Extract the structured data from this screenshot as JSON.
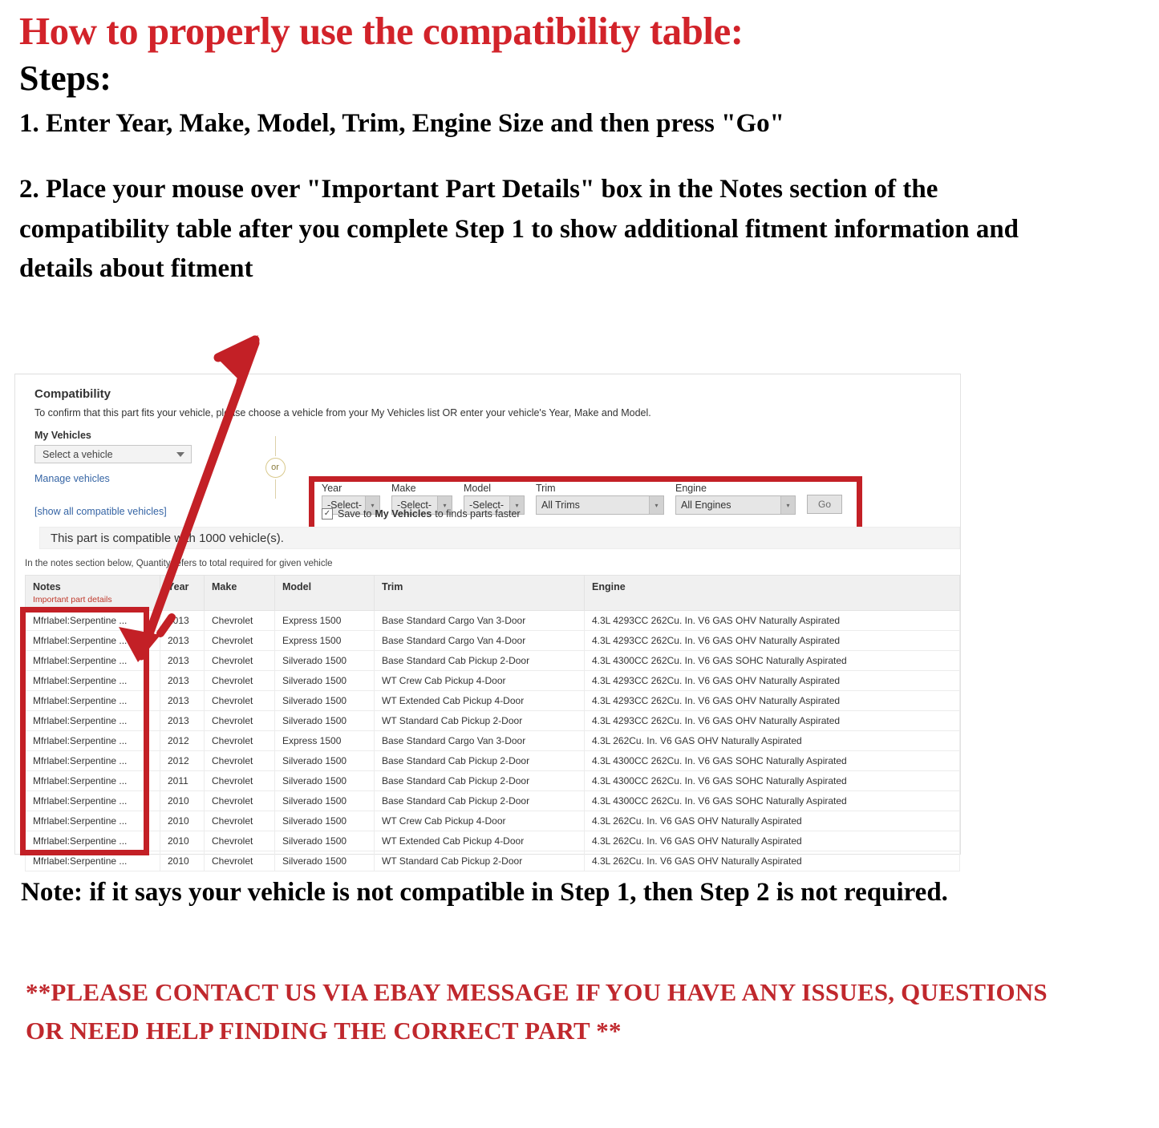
{
  "header": {
    "title": "How to properly use the compatibility table:",
    "steps_label": "Steps:",
    "step1": "1. Enter Year, Make, Model, Trim, Engine Size and then press \"Go\"",
    "step2": "2. Place your mouse over \"Important Part Details\" box in the Notes section of the compatibility table after you complete Step 1 to show additional fitment information and details about fitment"
  },
  "colors": {
    "accent_red": "#d2232a",
    "highlight_box": "#c32026",
    "link_blue": "#3665a5",
    "note_red": "#c0392b",
    "contact_red": "#c0282d"
  },
  "compatibility": {
    "title": "Compatibility",
    "subtitle": "To confirm that this part fits your vehicle, please choose a vehicle from your My Vehicles list OR enter your vehicle's Year, Make and Model.",
    "my_vehicles_label": "My Vehicles",
    "vehicle_select_value": "Select a vehicle",
    "manage_vehicles_link": "Manage vehicles",
    "show_all_link": "[show all compatible vehicles]",
    "or_label": "or",
    "form": {
      "fields": [
        {
          "label": "Year",
          "value": "-Select-"
        },
        {
          "label": "Make",
          "value": "-Select-"
        },
        {
          "label": "Model",
          "value": "-Select-"
        },
        {
          "label": "Trim",
          "value": "All Trims"
        },
        {
          "label": "Engine",
          "value": "All Engines"
        }
      ],
      "go_label": "Go",
      "save_checkbox_checked": true,
      "save_text_before": "Save to",
      "save_text_bold": "My Vehicles",
      "save_text_after": "to finds parts faster",
      "checkmark": "✓"
    },
    "banner": "This part is compatible with 1000 vehicle(s).",
    "notes_hint": "In the notes section below, Quantity refers to total required for given vehicle"
  },
  "table": {
    "columns": [
      {
        "label": "Notes",
        "sub": "Important part details"
      },
      {
        "label": "Year",
        "sub": ""
      },
      {
        "label": "Make",
        "sub": ""
      },
      {
        "label": "Model",
        "sub": ""
      },
      {
        "label": "Trim",
        "sub": ""
      },
      {
        "label": "Engine",
        "sub": ""
      }
    ],
    "rows": [
      {
        "notes": "Mfrlabel:Serpentine ...",
        "year": "2013",
        "make": "Chevrolet",
        "model": "Express 1500",
        "trim": "Base Standard Cargo Van 3-Door",
        "engine": "4.3L 4293CC 262Cu. In. V6 GAS OHV Naturally Aspirated"
      },
      {
        "notes": "Mfrlabel:Serpentine ...",
        "year": "2013",
        "make": "Chevrolet",
        "model": "Express 1500",
        "trim": "Base Standard Cargo Van 4-Door",
        "engine": "4.3L 4293CC 262Cu. In. V6 GAS OHV Naturally Aspirated"
      },
      {
        "notes": "Mfrlabel:Serpentine ...",
        "year": "2013",
        "make": "Chevrolet",
        "model": "Silverado 1500",
        "trim": "Base Standard Cab Pickup 2-Door",
        "engine": "4.3L 4300CC 262Cu. In. V6 GAS SOHC Naturally Aspirated"
      },
      {
        "notes": "Mfrlabel:Serpentine ...",
        "year": "2013",
        "make": "Chevrolet",
        "model": "Silverado 1500",
        "trim": "WT Crew Cab Pickup 4-Door",
        "engine": "4.3L 4293CC 262Cu. In. V6 GAS OHV Naturally Aspirated"
      },
      {
        "notes": "Mfrlabel:Serpentine ...",
        "year": "2013",
        "make": "Chevrolet",
        "model": "Silverado 1500",
        "trim": "WT Extended Cab Pickup 4-Door",
        "engine": "4.3L 4293CC 262Cu. In. V6 GAS OHV Naturally Aspirated"
      },
      {
        "notes": "Mfrlabel:Serpentine ...",
        "year": "2013",
        "make": "Chevrolet",
        "model": "Silverado 1500",
        "trim": "WT Standard Cab Pickup 2-Door",
        "engine": "4.3L 4293CC 262Cu. In. V6 GAS OHV Naturally Aspirated"
      },
      {
        "notes": "Mfrlabel:Serpentine ...",
        "year": "2012",
        "make": "Chevrolet",
        "model": "Express 1500",
        "trim": "Base Standard Cargo Van 3-Door",
        "engine": "4.3L 262Cu. In. V6 GAS OHV Naturally Aspirated"
      },
      {
        "notes": "Mfrlabel:Serpentine ...",
        "year": "2012",
        "make": "Chevrolet",
        "model": "Silverado 1500",
        "trim": "Base Standard Cab Pickup 2-Door",
        "engine": "4.3L 4300CC 262Cu. In. V6 GAS SOHC Naturally Aspirated"
      },
      {
        "notes": "Mfrlabel:Serpentine ...",
        "year": "2011",
        "make": "Chevrolet",
        "model": "Silverado 1500",
        "trim": "Base Standard Cab Pickup 2-Door",
        "engine": "4.3L 4300CC 262Cu. In. V6 GAS SOHC Naturally Aspirated"
      },
      {
        "notes": "Mfrlabel:Serpentine ...",
        "year": "2010",
        "make": "Chevrolet",
        "model": "Silverado 1500",
        "trim": "Base Standard Cab Pickup 2-Door",
        "engine": "4.3L 4300CC 262Cu. In. V6 GAS SOHC Naturally Aspirated"
      },
      {
        "notes": "Mfrlabel:Serpentine ...",
        "year": "2010",
        "make": "Chevrolet",
        "model": "Silverado 1500",
        "trim": "WT Crew Cab Pickup 4-Door",
        "engine": "4.3L 262Cu. In. V6 GAS OHV Naturally Aspirated"
      },
      {
        "notes": "Mfrlabel:Serpentine ...",
        "year": "2010",
        "make": "Chevrolet",
        "model": "Silverado 1500",
        "trim": "WT Extended Cab Pickup 4-Door",
        "engine": "4.3L 262Cu. In. V6 GAS OHV Naturally Aspirated"
      },
      {
        "notes": "Mfrlabel:Serpentine ...",
        "year": "2010",
        "make": "Chevrolet",
        "model": "Silverado 1500",
        "trim": "WT Standard Cab Pickup 2-Door",
        "engine": "4.3L 262Cu. In. V6 GAS OHV Naturally Aspirated"
      }
    ]
  },
  "footer": {
    "note": "Note: if it says your vehicle is not compatible in Step 1, then Step 2 is not required.",
    "contact": "**PLEASE CONTACT US VIA EBAY MESSAGE IF YOU HAVE ANY ISSUES, QUESTIONS OR NEED HELP FINDING THE CORRECT PART **"
  }
}
